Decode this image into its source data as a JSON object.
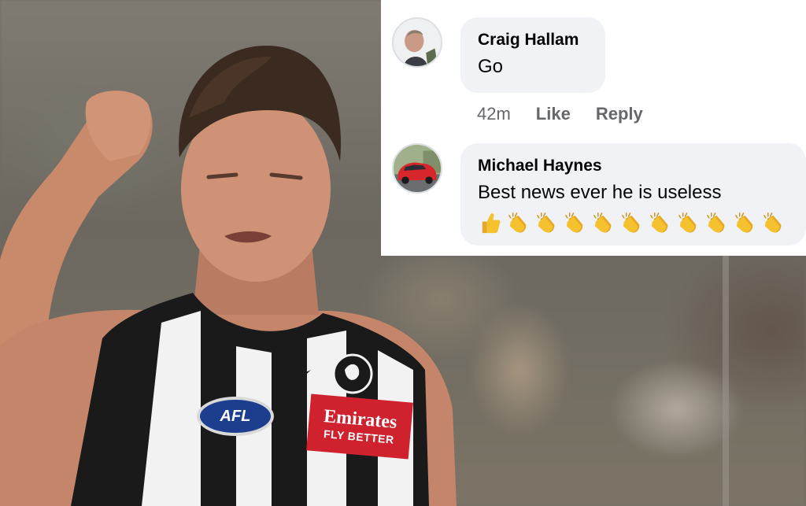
{
  "comments": [
    {
      "author": "Craig Hallam",
      "text": "Go",
      "time": "42m",
      "like_label": "Like",
      "reply_label": "Reply",
      "avatar_icon": "profile-photo"
    },
    {
      "author": "Michael Haynes",
      "text": "Best news ever he is useless",
      "avatar_icon": "red-car-profile-photo",
      "emojis": [
        "thumbs-up",
        "clapping-hands",
        "clapping-hands",
        "clapping-hands",
        "clapping-hands",
        "clapping-hands",
        "clapping-hands",
        "clapping-hands",
        "clapping-hands",
        "clapping-hands",
        "clapping-hands"
      ]
    }
  ],
  "jersey": {
    "league_badge": "AFL",
    "sponsor_line1": "Emirates",
    "sponsor_line2": "FLY BETTER"
  },
  "colors": {
    "bubble_bg": "#f0f2f5",
    "meta_text": "#65676b",
    "sponsor_red": "#d0222e",
    "emoji_yellow": "#f6c12f"
  }
}
